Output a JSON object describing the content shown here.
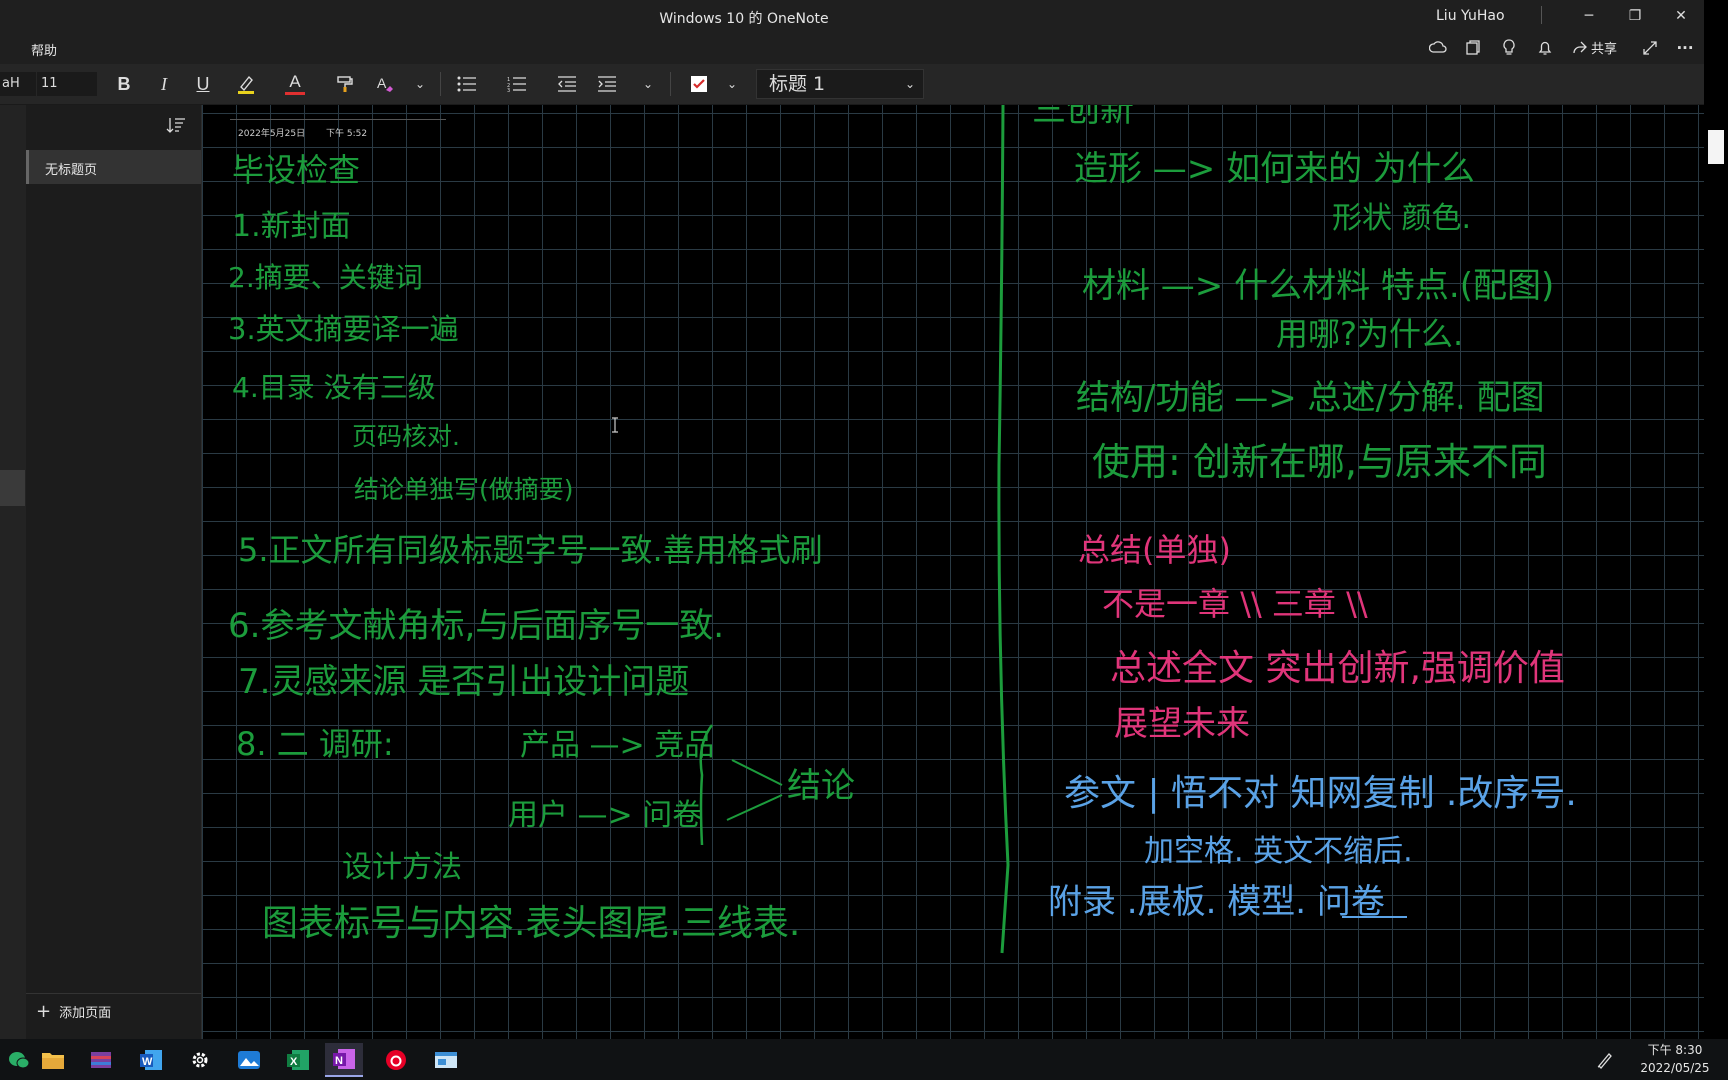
{
  "titlebar": {
    "title": "Windows 10 的 OneNote",
    "user": "Liu YuHao",
    "minimize": "─",
    "restore": "❐",
    "close": "✕"
  },
  "menubar": {
    "help": "帮助",
    "share": "共享",
    "more": "···"
  },
  "ribbon": {
    "font_name": "aH",
    "font_size": "11",
    "bold": "B",
    "italic": "I",
    "underline": "U",
    "font_color": "A",
    "style_value": "标题 1"
  },
  "pages_pane": {
    "page_title": "无标题页",
    "add_page": "添加页面"
  },
  "note": {
    "date": "2022年5月25日",
    "time": "下午 5:52"
  },
  "ink": {
    "left": [
      "毕设检查",
      "1.新封面",
      "2.摘要、关键词",
      "3.英文摘要译一遍",
      "4.目录 没有三级",
      "页码核对.",
      "结论单独写(做摘要)",
      "5.正文所有同级标题字号一致.善用格式刷",
      "6.参考文献角标,与后面序号一致.",
      "7.灵感来源 是否引出设计问题",
      "8. 二 调研:",
      "产品 —> 竞品",
      "用户 —> 问卷",
      "结论",
      "设计方法",
      "图表标号与内容.表头图尾.三线表."
    ],
    "right_green": [
      "三创新",
      "造形 —> 如何来的 为什么",
      "形状 颜色.",
      "材料 —> 什么材料 特点.(配图)",
      "用哪?为什么.",
      "结构/功能 —> 总述/分解. 配图",
      "使用: 创新在哪,与原来不同"
    ],
    "right_pink": [
      "总结(单独)",
      "不是一章 \\\\ 三章 \\\\",
      "总述全文 突出创新,强调价值",
      "展望未来"
    ],
    "right_blue": [
      "参文 | 悟不对 知网复制 .改序号.",
      "加空格. 英文不缩后.",
      "附录 .展板. 模型. 问卷"
    ]
  },
  "clock": {
    "time": "下午 8:30",
    "date": "2022/05/25"
  },
  "colors": {
    "ink_green": "#1c9c3c",
    "ink_pink": "#e0357a",
    "ink_blue": "#5aa2e6",
    "grid": "#2a3a44"
  }
}
